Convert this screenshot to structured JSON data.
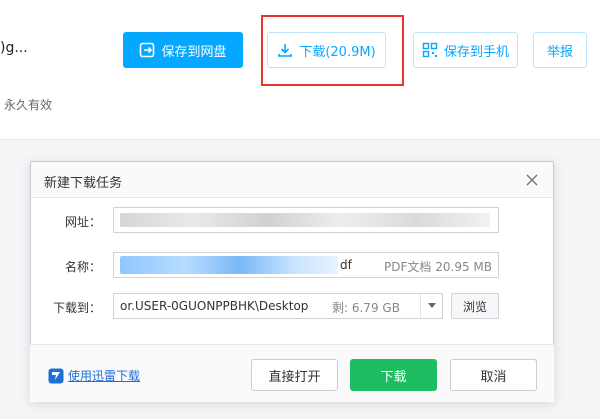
{
  "page": {
    "file_title": ")g...",
    "valid_text": "永久有效",
    "buttons": {
      "save_to_netdisk": "保存到网盘",
      "download": "下载(20.9M)",
      "save_to_phone": "保存到手机",
      "report": "举报"
    }
  },
  "dialog": {
    "title": "新建下载任务",
    "url_label": "网址：",
    "name_label": "名称：",
    "name_ext": "df",
    "name_meta": "PDF文档 20.95 MB",
    "path_label": "下载到：",
    "path_value": "or.USER-0GUONPPBHK\\Desktop",
    "path_free": "剩: 6.79 GB",
    "browse_label": "浏览",
    "thunder_link": "使用迅雷下载",
    "open_label": "直接打开",
    "download_label": "下载",
    "cancel_label": "取消"
  },
  "colors": {
    "primary_blue": "#06a7ff",
    "highlight_red": "#e8352d",
    "download_green": "#1fbc62"
  }
}
